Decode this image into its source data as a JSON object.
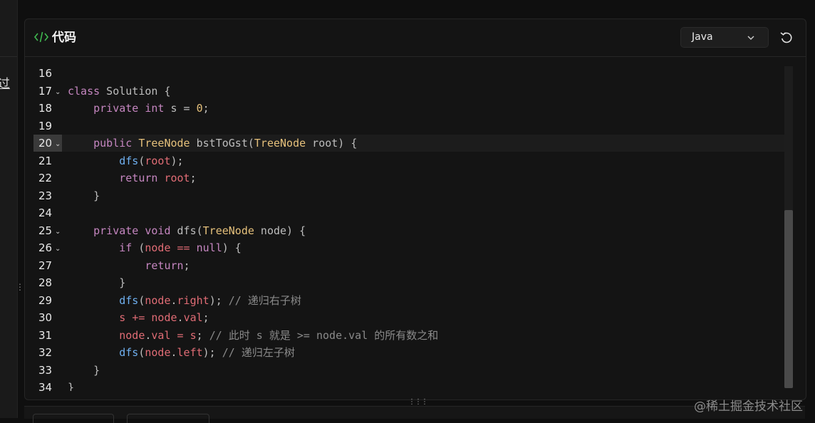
{
  "panel": {
    "title": "代码",
    "icon": "code-icon",
    "language": "Java",
    "reset_icon": "reset-icon"
  },
  "left": {
    "char": "过"
  },
  "editor": {
    "lines": [
      {
        "n": "16",
        "fold": false,
        "active": false,
        "tokens": []
      },
      {
        "n": "17",
        "fold": true,
        "active": false,
        "tokens": [
          [
            "kw",
            "class"
          ],
          [
            "pl",
            " Solution {"
          ]
        ]
      },
      {
        "n": "18",
        "fold": false,
        "active": false,
        "tokens": [
          [
            "pl",
            "    "
          ],
          [
            "kw",
            "private"
          ],
          [
            "pl",
            " "
          ],
          [
            "kw",
            "int"
          ],
          [
            "pl",
            " s = "
          ],
          [
            "num",
            "0"
          ],
          [
            "pl",
            ";"
          ]
        ]
      },
      {
        "n": "19",
        "fold": false,
        "active": false,
        "tokens": []
      },
      {
        "n": "20",
        "fold": true,
        "active": true,
        "tokens": [
          [
            "pl",
            "    "
          ],
          [
            "kw",
            "public"
          ],
          [
            "pl",
            " "
          ],
          [
            "typ",
            "TreeNode"
          ],
          [
            "pl",
            " bstToGst("
          ],
          [
            "typ",
            "TreeNode"
          ],
          [
            "pl",
            " root) {"
          ]
        ]
      },
      {
        "n": "21",
        "fold": false,
        "active": false,
        "tokens": [
          [
            "pl",
            "        "
          ],
          [
            "fn",
            "dfs"
          ],
          [
            "pl",
            "("
          ],
          [
            "var",
            "root"
          ],
          [
            "pl",
            ");"
          ]
        ]
      },
      {
        "n": "22",
        "fold": false,
        "active": false,
        "tokens": [
          [
            "pl",
            "        "
          ],
          [
            "kw",
            "return"
          ],
          [
            "pl",
            " "
          ],
          [
            "var",
            "root"
          ],
          [
            "pl",
            ";"
          ]
        ]
      },
      {
        "n": "23",
        "fold": false,
        "active": false,
        "tokens": [
          [
            "pl",
            "    }"
          ]
        ]
      },
      {
        "n": "24",
        "fold": false,
        "active": false,
        "tokens": []
      },
      {
        "n": "25",
        "fold": true,
        "active": false,
        "tokens": [
          [
            "pl",
            "    "
          ],
          [
            "kw",
            "private"
          ],
          [
            "pl",
            " "
          ],
          [
            "kw",
            "void"
          ],
          [
            "pl",
            " dfs("
          ],
          [
            "typ",
            "TreeNode"
          ],
          [
            "pl",
            " node) {"
          ]
        ]
      },
      {
        "n": "26",
        "fold": true,
        "active": false,
        "tokens": [
          [
            "pl",
            "        "
          ],
          [
            "kw",
            "if"
          ],
          [
            "pl",
            " ("
          ],
          [
            "var",
            "node"
          ],
          [
            "pl",
            " "
          ],
          [
            "op",
            "=="
          ],
          [
            "pl",
            " "
          ],
          [
            "kw",
            "null"
          ],
          [
            "pl",
            ") {"
          ]
        ]
      },
      {
        "n": "27",
        "fold": false,
        "active": false,
        "tokens": [
          [
            "pl",
            "            "
          ],
          [
            "kw",
            "return"
          ],
          [
            "pl",
            ";"
          ]
        ]
      },
      {
        "n": "28",
        "fold": false,
        "active": false,
        "tokens": [
          [
            "pl",
            "        }"
          ]
        ]
      },
      {
        "n": "29",
        "fold": false,
        "active": false,
        "tokens": [
          [
            "pl",
            "        "
          ],
          [
            "fn",
            "dfs"
          ],
          [
            "pl",
            "("
          ],
          [
            "var",
            "node"
          ],
          [
            "pl",
            "."
          ],
          [
            "var",
            "right"
          ],
          [
            "pl",
            "); "
          ],
          [
            "cm",
            "// 递归右子树"
          ]
        ]
      },
      {
        "n": "30",
        "fold": false,
        "active": false,
        "tokens": [
          [
            "pl",
            "        "
          ],
          [
            "var",
            "s"
          ],
          [
            "pl",
            " "
          ],
          [
            "op",
            "+="
          ],
          [
            "pl",
            " "
          ],
          [
            "var",
            "node"
          ],
          [
            "pl",
            "."
          ],
          [
            "var",
            "val"
          ],
          [
            "pl",
            ";"
          ]
        ]
      },
      {
        "n": "31",
        "fold": false,
        "active": false,
        "tokens": [
          [
            "pl",
            "        "
          ],
          [
            "var",
            "node"
          ],
          [
            "pl",
            "."
          ],
          [
            "var",
            "val"
          ],
          [
            "pl",
            " "
          ],
          [
            "op",
            "="
          ],
          [
            "pl",
            " "
          ],
          [
            "var",
            "s"
          ],
          [
            "pl",
            "; "
          ],
          [
            "cm",
            "// 此时 s 就是 >= node.val 的所有数之和"
          ]
        ]
      },
      {
        "n": "32",
        "fold": false,
        "active": false,
        "tokens": [
          [
            "pl",
            "        "
          ],
          [
            "fn",
            "dfs"
          ],
          [
            "pl",
            "("
          ],
          [
            "var",
            "node"
          ],
          [
            "pl",
            "."
          ],
          [
            "var",
            "left"
          ],
          [
            "pl",
            "); "
          ],
          [
            "cm",
            "// 递归左子树"
          ]
        ]
      },
      {
        "n": "33",
        "fold": false,
        "active": false,
        "tokens": [
          [
            "pl",
            "    }"
          ]
        ]
      },
      {
        "n": "34",
        "fold": false,
        "active": false,
        "tokens": [
          [
            "pl",
            "}"
          ]
        ]
      }
    ]
  },
  "watermark": "@稀土掘金技术社区"
}
